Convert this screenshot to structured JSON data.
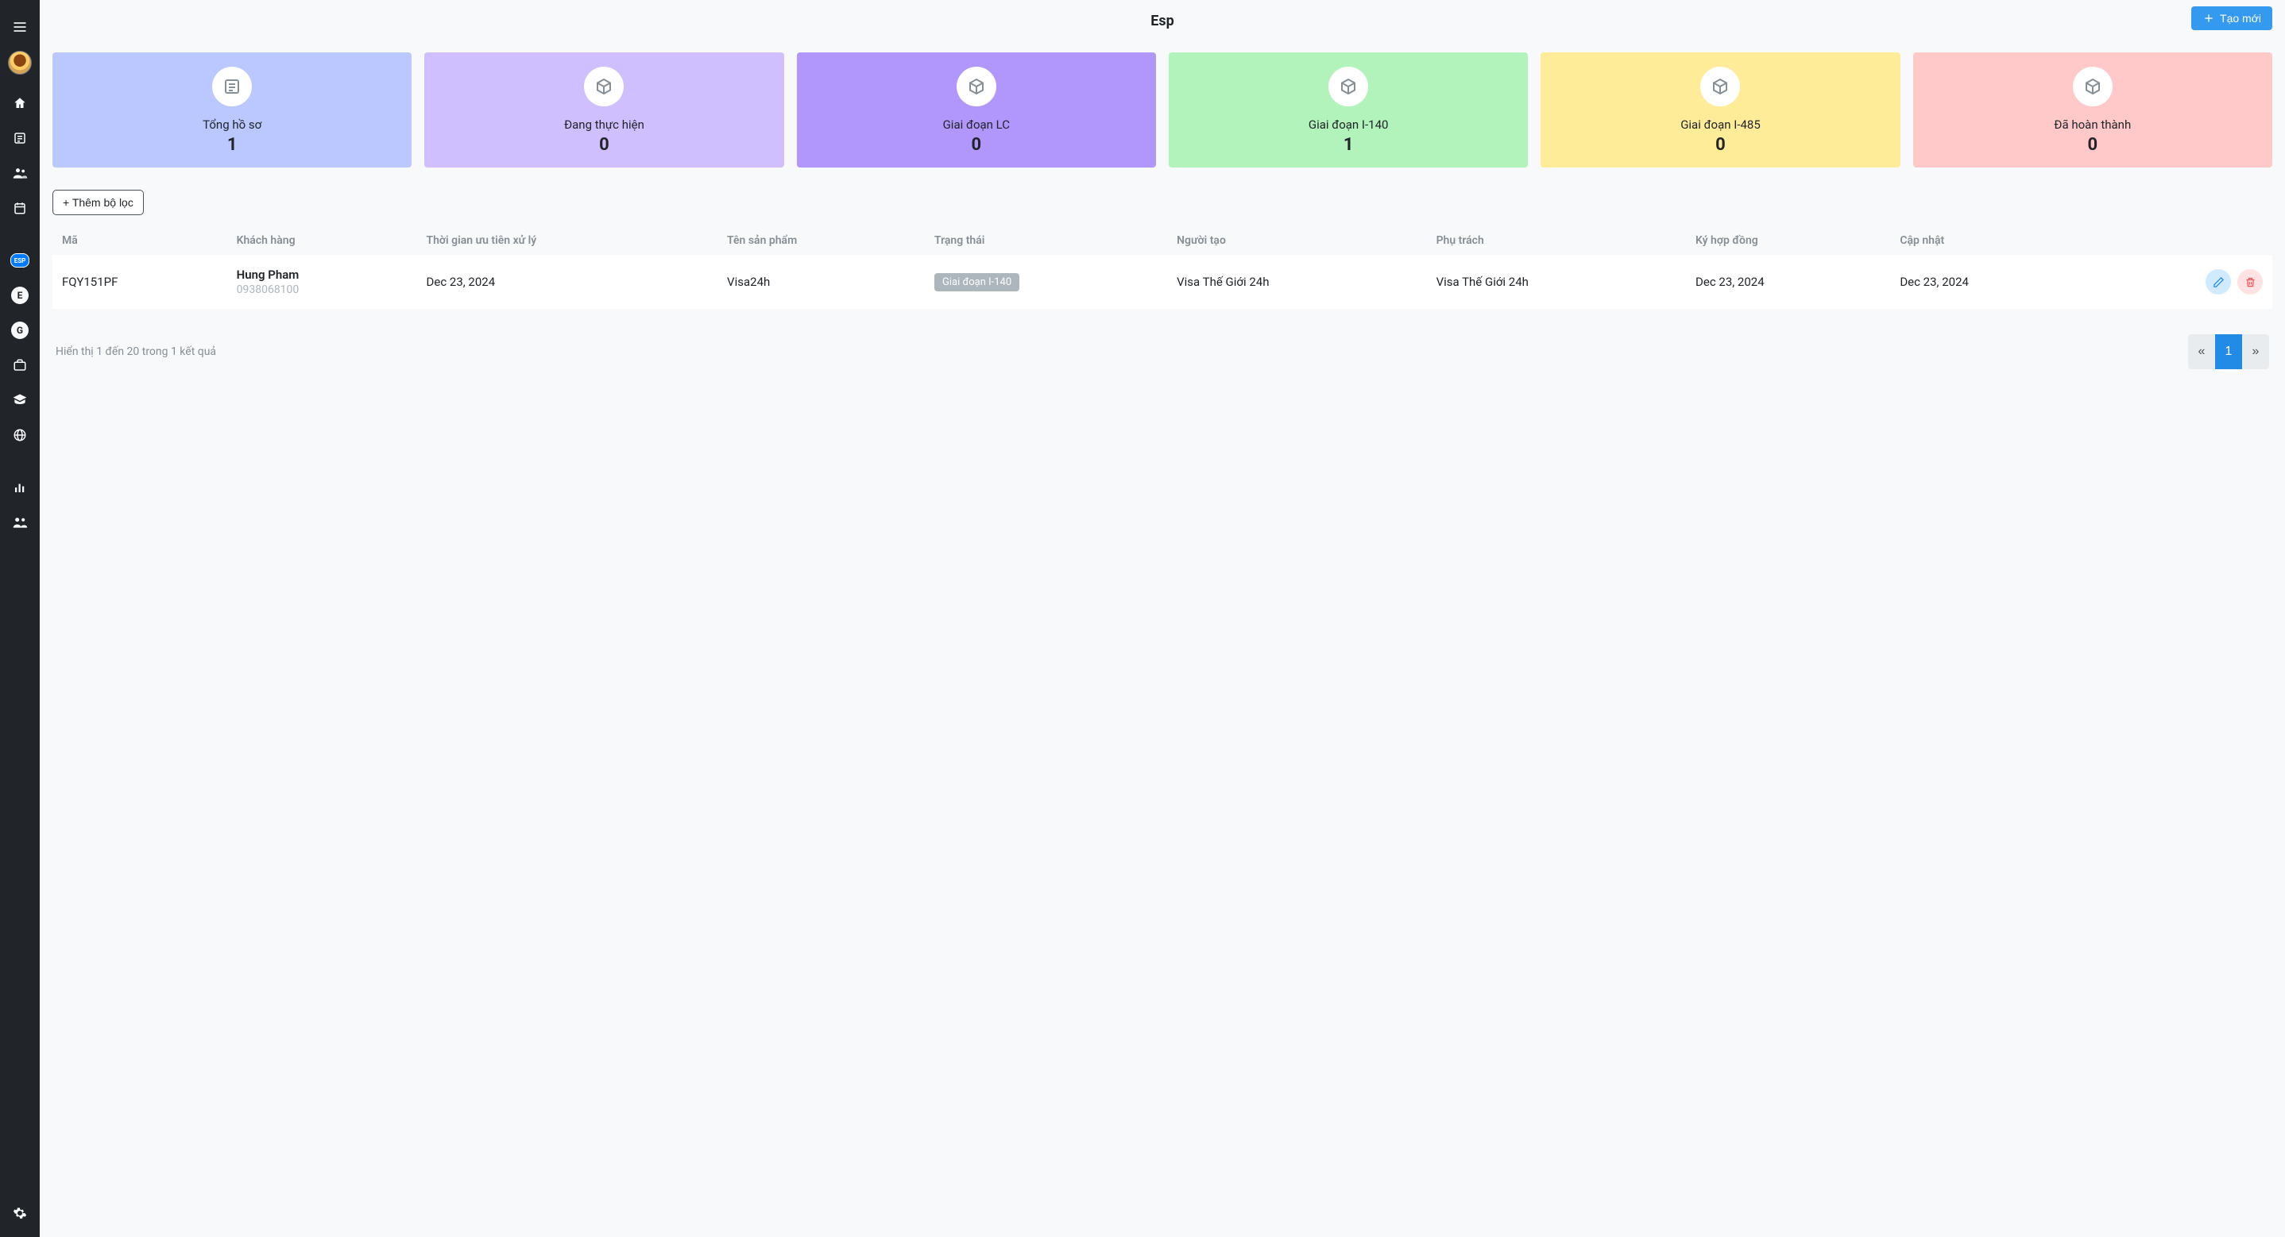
{
  "header": {
    "title": "Esp",
    "create_label": "Tạo mới"
  },
  "stats": [
    {
      "label": "Tổng hồ sơ",
      "value": "1",
      "color": "c-blue",
      "icon": "list"
    },
    {
      "label": "Đang thực hiện",
      "value": "0",
      "color": "c-purple",
      "icon": "box"
    },
    {
      "label": "Giai đoạn LC",
      "value": "0",
      "color": "c-violet",
      "icon": "box"
    },
    {
      "label": "Giai đoạn I-140",
      "value": "1",
      "color": "c-green",
      "icon": "box"
    },
    {
      "label": "Giai đoạn I-485",
      "value": "0",
      "color": "c-yellow",
      "icon": "box"
    },
    {
      "label": "Đã hoàn thành",
      "value": "0",
      "color": "c-red",
      "icon": "box"
    }
  ],
  "filter_button": "+ Thêm bộ lọc",
  "table": {
    "columns": [
      "Mã",
      "Khách hàng",
      "Thời gian ưu tiên xử lý",
      "Tên sản phẩm",
      "Trạng thái",
      "Người tạo",
      "Phụ trách",
      "Ký hợp đồng",
      "Cập nhật"
    ],
    "rows": [
      {
        "code": "FQY151PF",
        "customer_name": "Hung Pham",
        "customer_phone": "0938068100",
        "priority_time": "Dec 23, 2024",
        "product": "Visa24h",
        "status": "Giai đoạn I-140",
        "creator": "Visa Thế Giới 24h",
        "assignee": "Visa Thế Giới 24h",
        "contract_date": "Dec 23, 2024",
        "updated": "Dec 23, 2024"
      }
    ]
  },
  "pagination": {
    "info": "Hiển thị 1 đến 20 trong 1 kết quả",
    "current": "1"
  },
  "sidebar": {
    "e_letter": "E",
    "g_letter": "G",
    "esp_label": "ESP"
  }
}
